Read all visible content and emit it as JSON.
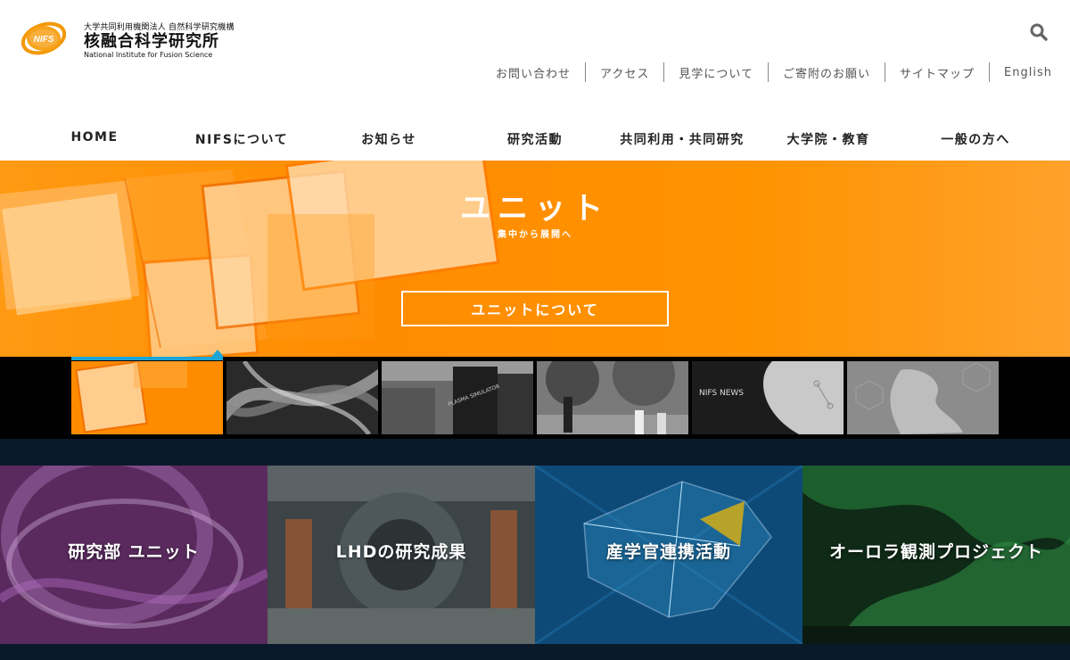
{
  "header": {
    "logo_sub": "大学共同利用機関法人 自然科学研究機構",
    "logo_main": "核融合科学研究所",
    "logo_en": "National Institute for Fusion Science",
    "logo_mark_text": "NIFS",
    "search_icon": "search-icon"
  },
  "utility_links": [
    {
      "label": "お問い合わせ"
    },
    {
      "label": "アクセス"
    },
    {
      "label": "見学について"
    },
    {
      "label": "ご寄附のお願い"
    },
    {
      "label": "サイトマップ"
    },
    {
      "label": "English"
    }
  ],
  "main_nav": [
    {
      "label": "HOME"
    },
    {
      "label": "NIFSについて"
    },
    {
      "label": "お知らせ"
    },
    {
      "label": "研究活動"
    },
    {
      "label": "共同利用・共同研究"
    },
    {
      "label": "大学院・教育"
    },
    {
      "label": "一般の方へ"
    }
  ],
  "hero": {
    "title": "ユニット",
    "subtitle": "集中から展開へ",
    "button_label": "ユニットについて"
  },
  "thumbnails": {
    "active_index": 0,
    "thumb4_text": "NIFS NEWS",
    "thumb2_text": "PLASMA SIMULATOR"
  },
  "cards": [
    {
      "label": "研究部 ユニット"
    },
    {
      "label": "LHDの研究成果"
    },
    {
      "label": "産学官連携活動"
    },
    {
      "label": "オーロラ観測プロジェクト"
    }
  ],
  "colors": {
    "accent_orange": "#ff8c00",
    "active_indicator": "#1aa5d6",
    "navy": "#0b1a2b"
  }
}
